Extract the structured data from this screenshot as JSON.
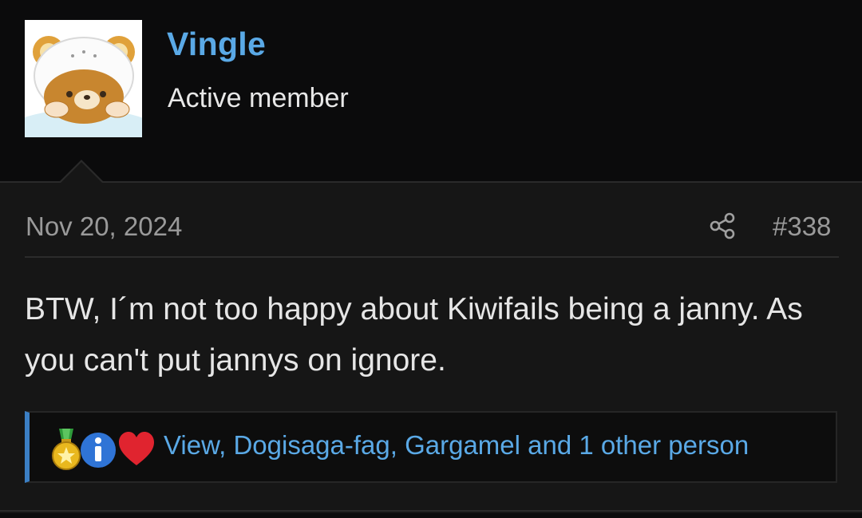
{
  "user": {
    "name": "Vingle",
    "title": "Active member",
    "avatar_icon": "bear-avatar-icon"
  },
  "post": {
    "date": "Nov 20, 2024",
    "number": "#338",
    "share_icon": "share-icon",
    "body": "BTW, I´m not too happy about Kiwifails being a janny. As you can't put jannys on ignore."
  },
  "reactions": {
    "icons": [
      "medal-icon",
      "info-icon",
      "heart-icon"
    ],
    "text": "View, Dogisaga-fag, Gargamel and 1 other person"
  },
  "colors": {
    "background": "#0b0b0c",
    "post_background": "#161616",
    "accent_link": "#5aa9e6",
    "reaction_bar_accent": "#3b7fc4"
  }
}
